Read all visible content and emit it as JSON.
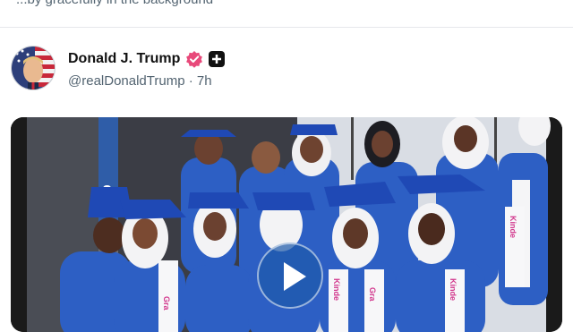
{
  "previous_post": {
    "tail_text": "...by gracefully in the background"
  },
  "post": {
    "author_name": "Donald J. Trump",
    "handle": "@realDonaldTrump",
    "separator": " · ",
    "time_ago": "7h",
    "verified_color": "#e8497a",
    "media": {
      "type": "video",
      "sign_number": "2",
      "sash_texts": [
        "Kinde",
        "Gra",
        "Gra",
        "Kinde",
        "Kinde"
      ]
    }
  },
  "icons": {
    "verified": "verified-badge-icon",
    "plus": "plus-square-icon",
    "play": "play-icon",
    "avatar": "flag-portrait-avatar"
  }
}
